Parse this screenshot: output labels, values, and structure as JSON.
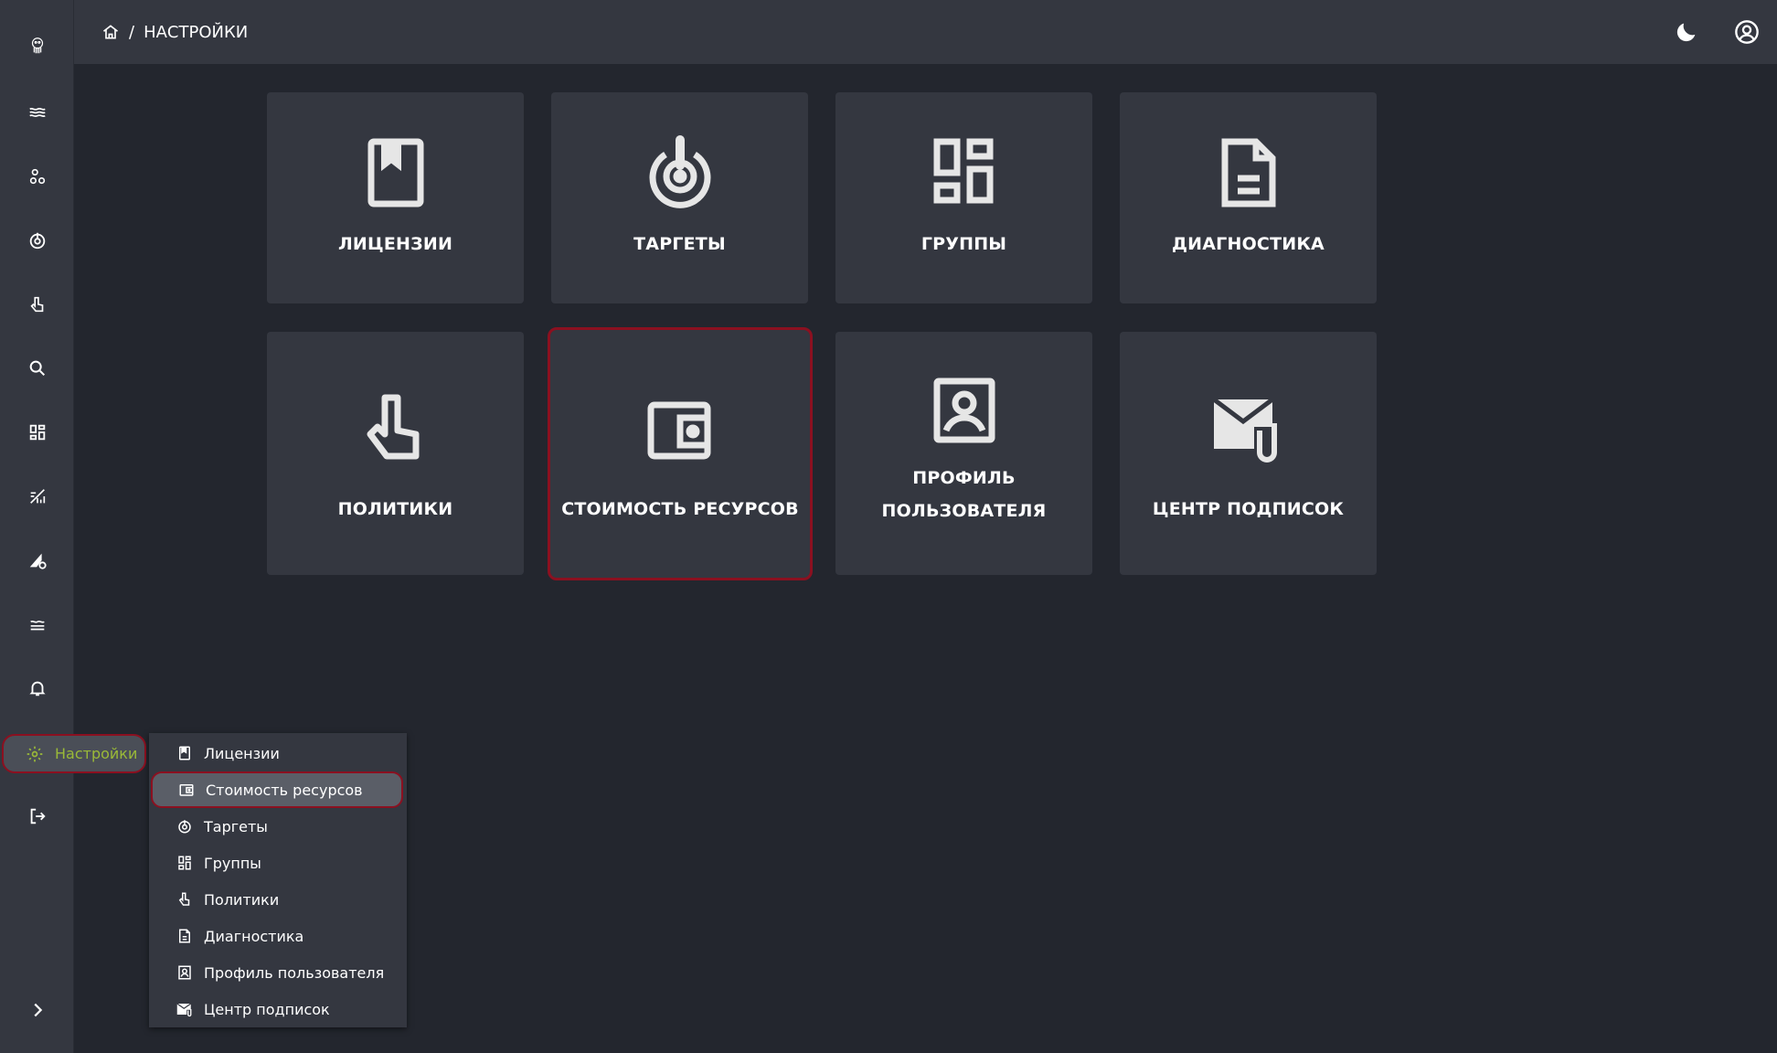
{
  "breadcrumb": {
    "current": "НАСТРОЙКИ"
  },
  "sidebar": {
    "icons": [
      "logo-icon",
      "waves-icon",
      "nodes-icon",
      "target-icon",
      "pointer-icon",
      "search-icon",
      "grid-icon",
      "chart-icon",
      "shape-gear-icon",
      "layers-icon",
      "bell-icon"
    ],
    "active_label": "Настройки",
    "bottom_icons": [
      "logout-icon",
      "chevron-right-icon"
    ]
  },
  "tiles": [
    {
      "label": "ЛИЦЕНЗИИ",
      "icon": "book-icon"
    },
    {
      "label": "ТАРГЕТЫ",
      "icon": "target-icon"
    },
    {
      "label": "ГРУППЫ",
      "icon": "grid-icon"
    },
    {
      "label": "ДИАГНОСТИКА",
      "icon": "document-icon"
    },
    {
      "label": "ПОЛИТИКИ",
      "icon": "pointer-icon"
    },
    {
      "label": "СТОИМОСТЬ РЕСУРСОВ",
      "icon": "wallet-icon"
    },
    {
      "label_line1": "ПРОФИЛЬ",
      "label_line2": "ПОЛЬЗОВАТЕЛЯ",
      "icon": "profile-icon"
    },
    {
      "label": "ЦЕНТР ПОДПИСОК",
      "icon": "mail-attachment-icon"
    }
  ],
  "menu": [
    {
      "label": "Лицензии",
      "icon": "book-icon"
    },
    {
      "label": "Стоимость ресурсов",
      "icon": "wallet-icon"
    },
    {
      "label": "Таргеты",
      "icon": "target-icon"
    },
    {
      "label": "Группы",
      "icon": "grid-icon"
    },
    {
      "label": "Политики",
      "icon": "pointer-icon"
    },
    {
      "label": "Диагностика",
      "icon": "document-icon"
    },
    {
      "label": "Профиль пользователя",
      "icon": "profile-icon"
    },
    {
      "label": "Центр подписок",
      "icon": "mail-attachment-icon"
    }
  ],
  "colors": {
    "accent_green": "#9ab938",
    "highlight_red": "#8b1020",
    "panel": "#343740",
    "background": "#23262e"
  }
}
